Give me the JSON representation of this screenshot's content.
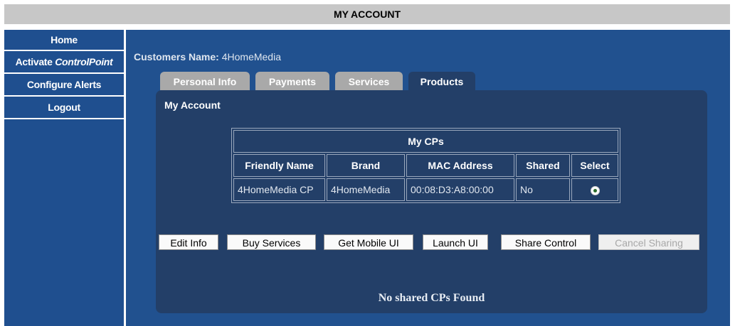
{
  "header": {
    "title": "MY ACCOUNT"
  },
  "sidebar": {
    "items": [
      {
        "label": "Home"
      },
      {
        "label_prefix": "Activate ",
        "label_italic": "ControlPoint"
      },
      {
        "label": "Configure Alerts"
      },
      {
        "label": "Logout"
      }
    ]
  },
  "customer": {
    "label": "Customers Name:",
    "value": "4HomeMedia"
  },
  "tabs": [
    "Personal Info",
    "Payments",
    "Services",
    "Products"
  ],
  "active_tab": "Products",
  "panel": {
    "title": "My Account"
  },
  "cp_table": {
    "caption": "My CPs",
    "headers": [
      "Friendly Name",
      "Brand",
      "MAC Address",
      "Shared",
      "Select"
    ],
    "rows": [
      {
        "friendly_name": "4HomeMedia CP",
        "brand": "4HomeMedia",
        "mac": "00:08:D3:A8:00:00",
        "shared": "No",
        "selected": true
      }
    ]
  },
  "buttons": {
    "edit_info": "Edit Info",
    "buy_services": "Buy Services",
    "get_mobile_ui": "Get Mobile UI",
    "launch_ui": "Launch UI",
    "share_control": "Share Control",
    "cancel_sharing": "Cancel Sharing"
  },
  "status": {
    "no_shared": "No shared CPs Found"
  },
  "colors": {
    "sidebar": "#1f4f8f",
    "main": "#21518f",
    "panel": "#233f68",
    "tab_inactive": "#a9a9a9",
    "titlebar": "#c7c7c7"
  }
}
